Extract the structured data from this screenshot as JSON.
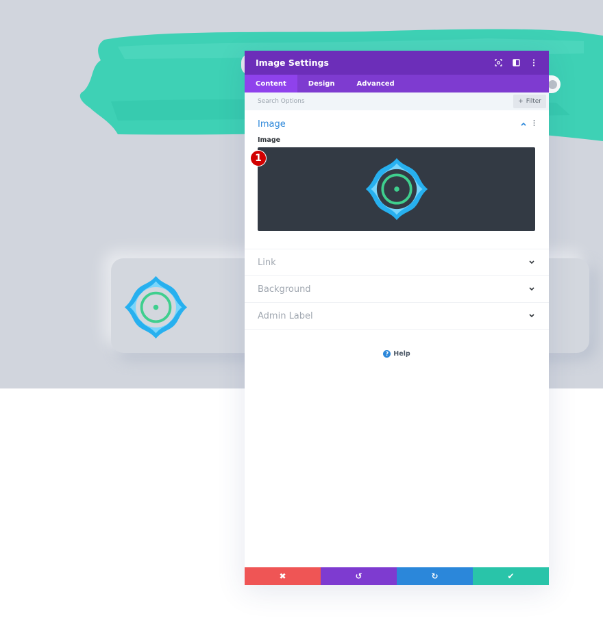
{
  "modal": {
    "title": "Image Settings",
    "header_icons": [
      "fullscreen-icon",
      "split-view-icon",
      "more-options-icon"
    ],
    "tabs": [
      {
        "label": "Content",
        "active": true
      },
      {
        "label": "Design",
        "active": false
      },
      {
        "label": "Advanced",
        "active": false
      }
    ],
    "search": {
      "placeholder": "Search Options",
      "value": ""
    },
    "filter": {
      "label": "Filter",
      "icon": "+"
    },
    "sections": {
      "image": {
        "title": "Image",
        "field_label": "Image",
        "expanded": true
      },
      "closed": [
        {
          "title": "Link"
        },
        {
          "title": "Background"
        },
        {
          "title": "Admin Label"
        }
      ]
    },
    "help_label": "Help",
    "footer": {
      "cancel_icon": "✖",
      "undo_icon": "↺",
      "redo_icon": "↻",
      "save_icon": "✔"
    }
  },
  "annotation": {
    "badge_number": "1"
  },
  "colors": {
    "header": "#6c2eb9",
    "tabs": "#7e3bd0",
    "active_tab": "#8f42ec",
    "accent_blue": "#2b87da",
    "cancel": "#ef5555",
    "undo": "#7e3bd0",
    "redo": "#2b87da",
    "save": "#29c4a9",
    "brush": "#3ed1b5",
    "icon_blue": "#27b0ef",
    "icon_green": "#3fcf8e"
  }
}
